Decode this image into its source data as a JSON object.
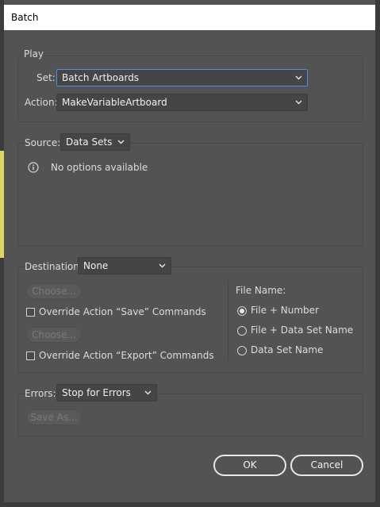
{
  "window": {
    "title": "Batch"
  },
  "play": {
    "legend": "Play",
    "set_label": "Set:",
    "set_value": "Batch Artboards",
    "action_label": "Action:",
    "action_value": "MakeVariableArtboard"
  },
  "source": {
    "label": "Source:",
    "value": "Data Sets",
    "info_text": "No options available"
  },
  "destination": {
    "label": "Destination:",
    "value": "None",
    "choose_label_1": "Choose...",
    "override_save_label": "Override Action “Save” Commands",
    "override_save_checked": false,
    "choose_label_2": "Choose...",
    "override_export_label": "Override Action “Export” Commands",
    "override_export_checked": false,
    "file_name": {
      "heading": "File Name:",
      "options": [
        "File + Number",
        "File + Data Set Name",
        "Data Set Name"
      ],
      "selected": "File + Number"
    }
  },
  "errors": {
    "label": "Errors:",
    "value": "Stop for Errors",
    "save_as_label": "Save As..."
  },
  "buttons": {
    "ok": "OK",
    "cancel": "Cancel"
  },
  "colors": {
    "accent_focus": "#4a90e2",
    "panel_bg": "#535353",
    "title_bg": "#ffffff"
  },
  "icons": {
    "dropdown": "chevron-down-icon",
    "info": "info-icon"
  }
}
